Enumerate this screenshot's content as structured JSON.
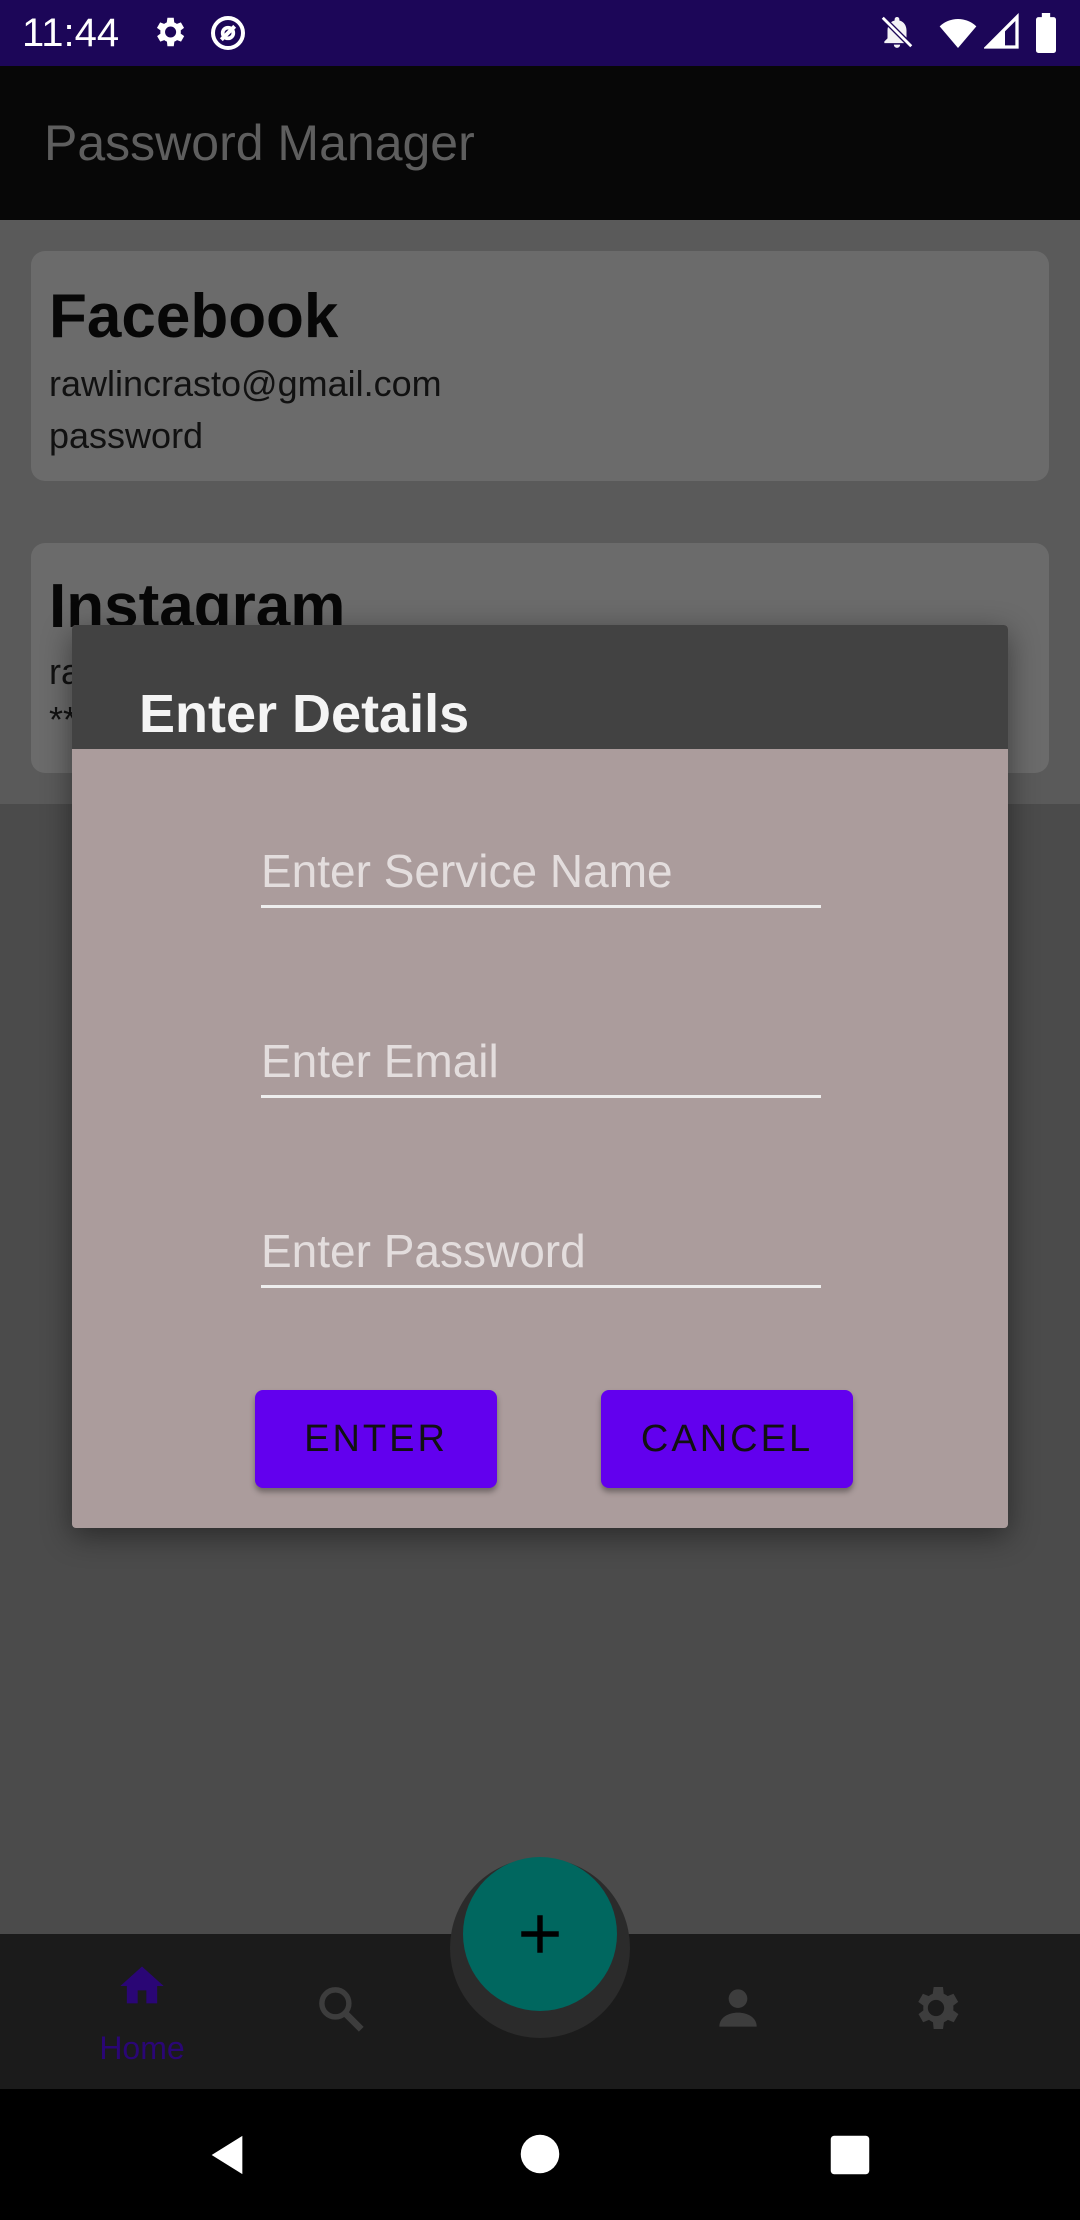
{
  "status_bar": {
    "time": "11:44",
    "icons": [
      "gear-icon",
      "at-sign-icon",
      "notifications-off-icon",
      "wifi-icon",
      "signal-icon",
      "battery-icon"
    ]
  },
  "app_bar": {
    "title": "Password Manager"
  },
  "entries": [
    {
      "service": "Facebook",
      "email": "rawlincrasto@gmail.com",
      "password": "password"
    },
    {
      "service": "Instagram",
      "email": "ra",
      "password": "**"
    }
  ],
  "dialog": {
    "title": "Enter Details",
    "service_placeholder": "Enter Service Name",
    "email_placeholder": "Enter Email",
    "password_placeholder": "Enter Password",
    "enter_label": "ENTER",
    "cancel_label": "CANCEL"
  },
  "bottom_nav": {
    "items": [
      {
        "label": "Home",
        "icon": "home-icon",
        "active": true
      },
      {
        "label": "",
        "icon": "search-icon",
        "active": false
      },
      {
        "label": "",
        "icon": "person-icon",
        "active": false
      },
      {
        "label": "",
        "icon": "gear-icon",
        "active": false
      }
    ],
    "fab_icon": "plus-icon"
  },
  "colors": {
    "accent": "#6200ee",
    "fab": "#00675f",
    "status_bar": "#1c0658",
    "dialog_body": "#ab9c9c",
    "dialog_header": "#424242"
  }
}
